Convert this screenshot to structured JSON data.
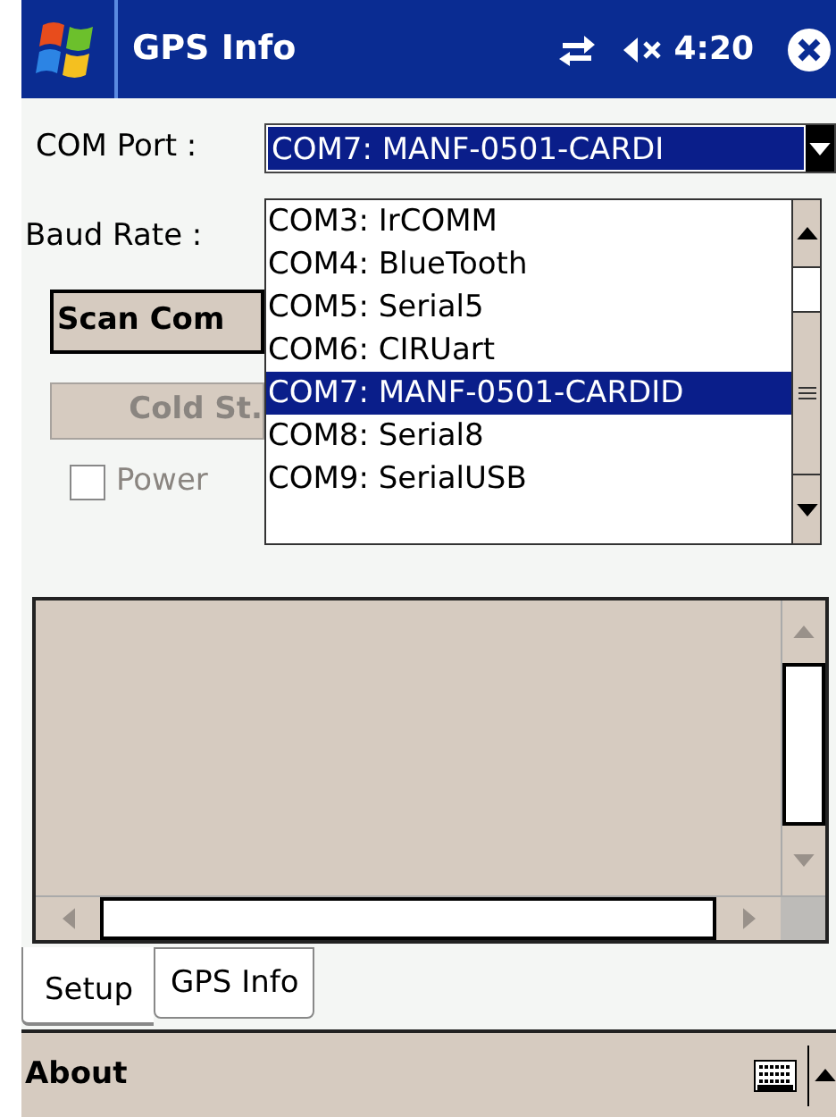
{
  "title_bar": {
    "title": "GPS Info",
    "clock": "4:20"
  },
  "com_port": {
    "label": "COM Port :",
    "value": "COM7:  MANF-0501-CARDI",
    "expanded": true,
    "options": [
      {
        "label": "COM3:  IrCOMM",
        "selected": false
      },
      {
        "label": "COM4:  BlueTooth",
        "selected": false
      },
      {
        "label": "COM5:  Serial5",
        "selected": false
      },
      {
        "label": "COM6:  CIRUart",
        "selected": false
      },
      {
        "label": "COM7:  MANF-0501-CARDID",
        "selected": true
      },
      {
        "label": "COM8:  Serial8",
        "selected": false
      },
      {
        "label": "COM9:  SerialUSB",
        "selected": false
      }
    ]
  },
  "baud_rate": {
    "label": "Baud Rate :"
  },
  "buttons": [
    {
      "label": "Scan Com",
      "disabled": false
    },
    {
      "label": "Cold St.",
      "disabled": true
    }
  ],
  "power_checkbox": {
    "label": "Power",
    "checked": false,
    "disabled": true
  },
  "tabs": [
    {
      "label": "Setup",
      "selected": true
    },
    {
      "label": "GPS Info",
      "selected": false
    }
  ],
  "menu_bar": {
    "left": "About"
  }
}
